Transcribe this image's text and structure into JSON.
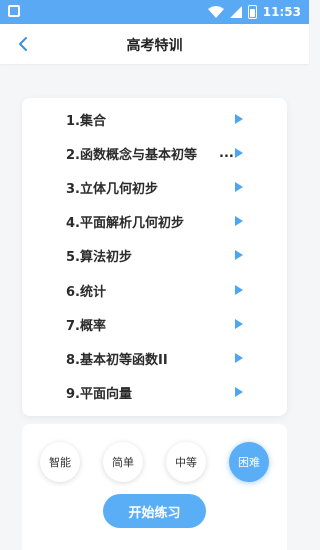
{
  "status_bar": {
    "time": "11:53"
  },
  "header": {
    "title": "高考特训"
  },
  "chapters": [
    {
      "label": "1.集合"
    },
    {
      "label": "2.函数概念与基本初等"
    },
    {
      "label": "3.立体几何初步"
    },
    {
      "label": "4.平面解析几何初步"
    },
    {
      "label": "5.算法初步"
    },
    {
      "label": "6.统计"
    },
    {
      "label": "7.概率"
    },
    {
      "label": "8.基本初等函数II"
    },
    {
      "label": "9.平面向量"
    }
  ],
  "chapter_ellipsis": "...",
  "levels": [
    {
      "label": "智能",
      "active": false
    },
    {
      "label": "简单",
      "active": false
    },
    {
      "label": "中等",
      "active": false
    },
    {
      "label": "困难",
      "active": true
    }
  ],
  "start_button": "开始练习",
  "colors": {
    "accent": "#5aaef6",
    "status_bar": "#5aa9f5"
  }
}
